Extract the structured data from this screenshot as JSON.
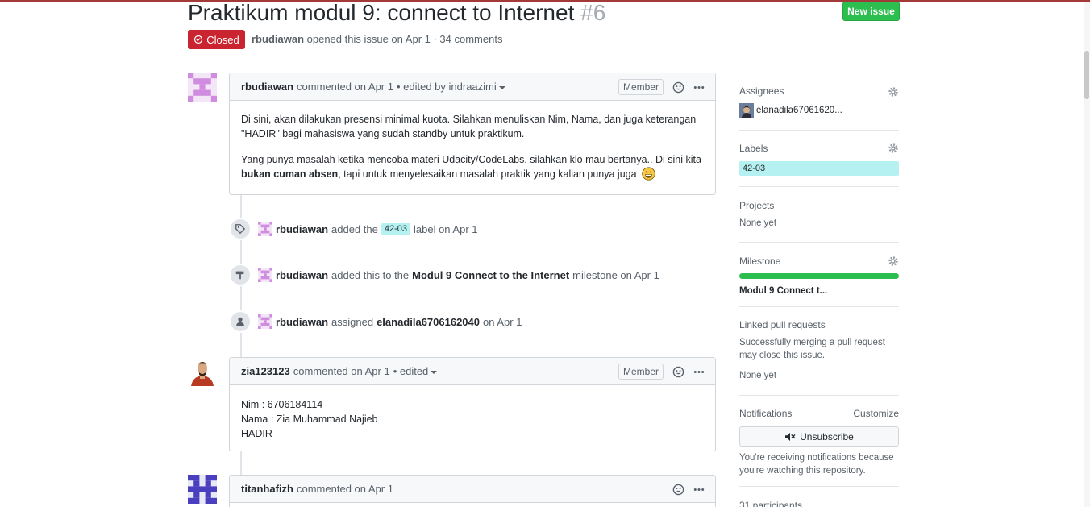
{
  "issue": {
    "title": "Praktikum modul 9: connect to Internet",
    "number": "#6",
    "state": "Closed",
    "author": "rbudiawan",
    "meta_text": "opened this issue on Apr 1 · 34 comments",
    "new_issue_label": "New issue"
  },
  "comments": [
    {
      "author": "rbudiawan",
      "action": "commented on Apr 1",
      "edited": "• edited by indraazimi",
      "role": "Member",
      "paragraph1": "Di sini, akan dilakukan presensi minimal kuota. Silahkan menuliskan Nim, Nama, dan juga keterangan \"HADIR\" bagi mahasiswa yang sudah standby untuk praktikum.",
      "paragraph2_pre": "Yang punya masalah ketika mencoba materi Udacity/CodeLabs, silahkan klo mau bertanya.. Di sini kita ",
      "paragraph2_bold": "bukan cuman absen",
      "paragraph2_post": ", tapi untuk menyelesaikan masalah praktik yang kalian punya juga"
    },
    {
      "author": "zia123123",
      "action": "commented on Apr 1",
      "edited": "• edited",
      "role": "Member",
      "line1": "Nim : 6706184114",
      "line2": "Nama : Zia Muhammad Najieb",
      "line3": "HADIR"
    },
    {
      "author": "titanhafizh",
      "action": "commented on Apr 1"
    }
  ],
  "events": [
    {
      "actor": "rbudiawan",
      "pre": "added the",
      "label": "42-03",
      "post": "label on Apr 1",
      "icon": "tag-icon"
    },
    {
      "actor": "rbudiawan",
      "pre": "added this to the",
      "milestone": "Modul 9 Connect to the Internet",
      "post": "milestone on Apr 1",
      "icon": "milestone-icon"
    },
    {
      "actor": "rbudiawan",
      "pre": "assigned",
      "assignee": "elanadila6706162040",
      "post": "on Apr 1",
      "icon": "person-icon"
    }
  ],
  "sidebar": {
    "assignees_heading": "Assignees",
    "assignee_name": "elanadila67061620...",
    "labels_heading": "Labels",
    "label_value": "42-03",
    "projects_heading": "Projects",
    "projects_value": "None yet",
    "milestone_heading": "Milestone",
    "milestone_progress": 1.0,
    "milestone_value": "Modul 9 Connect t...",
    "linked_heading": "Linked pull requests",
    "linked_desc": "Successfully merging a pull request may close this issue.",
    "linked_value": "None yet",
    "notifications_heading": "Notifications",
    "customize_label": "Customize",
    "unsubscribe_label": "Unsubscribe",
    "notif_desc": "You're receiving notifications because you're watching this repository.",
    "participants": "31 participants"
  },
  "colors": {
    "closed": "#cb2431",
    "new_issue": "#2cbe4e",
    "label": "#b6f1f1",
    "progress": "#2cbe4e"
  }
}
